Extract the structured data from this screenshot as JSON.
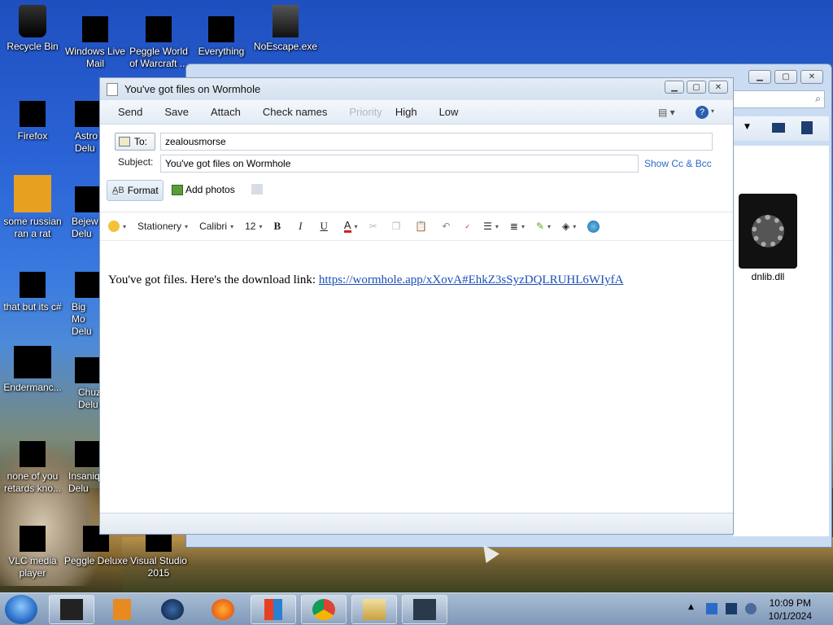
{
  "desktop": {
    "icons": [
      {
        "label": "Recycle Bin"
      },
      {
        "label": "Windows Live Mail"
      },
      {
        "label": "Peggle World of Warcraft ..."
      },
      {
        "label": "Everything"
      },
      {
        "label": "NoEscape.exe"
      },
      {
        "label": "Firefox"
      },
      {
        "label": "Astro Delu"
      },
      {
        "label": "some russian ran a rat"
      },
      {
        "label": "Bejew Delu"
      },
      {
        "label": "that but its c#"
      },
      {
        "label": "Big Mo Delu"
      },
      {
        "label": "Endermanc..."
      },
      {
        "label": "Chuz Delu"
      },
      {
        "label": "none of you retards kno..."
      },
      {
        "label": "Insaniq Delu"
      },
      {
        "label": "VLC media player"
      },
      {
        "label": "Peggle Deluxe"
      },
      {
        "label": "Visual Studio 2015"
      }
    ]
  },
  "explorer": {
    "file_label": "dnlib.dll"
  },
  "mail": {
    "title": "You've got files on Wormhole",
    "commands": {
      "send": "Send",
      "save": "Save",
      "attach": "Attach",
      "check_names": "Check names",
      "priority": "Priority",
      "high": "High",
      "low": "Low"
    },
    "to_label": "To:",
    "to_value": "zealousmorse",
    "subject_label": "Subject:",
    "subject_value": "You've got files on Wormhole",
    "show_cc": "Show Cc & Bcc",
    "format_label": "Format",
    "add_photos": "Add photos",
    "toolbar": {
      "stationery": "Stationery",
      "font": "Calibri",
      "size": "12",
      "bold": "B",
      "italic": "I",
      "underline": "U",
      "color": "A"
    },
    "body_text": "You've got files. Here's the download link: ",
    "body_link": "https://wormhole.app/xXovA#EhkZ3sSyzDQLRUHL6WIyfA"
  },
  "taskbar": {
    "time": "10:09 PM",
    "date": "10/1/2024"
  }
}
